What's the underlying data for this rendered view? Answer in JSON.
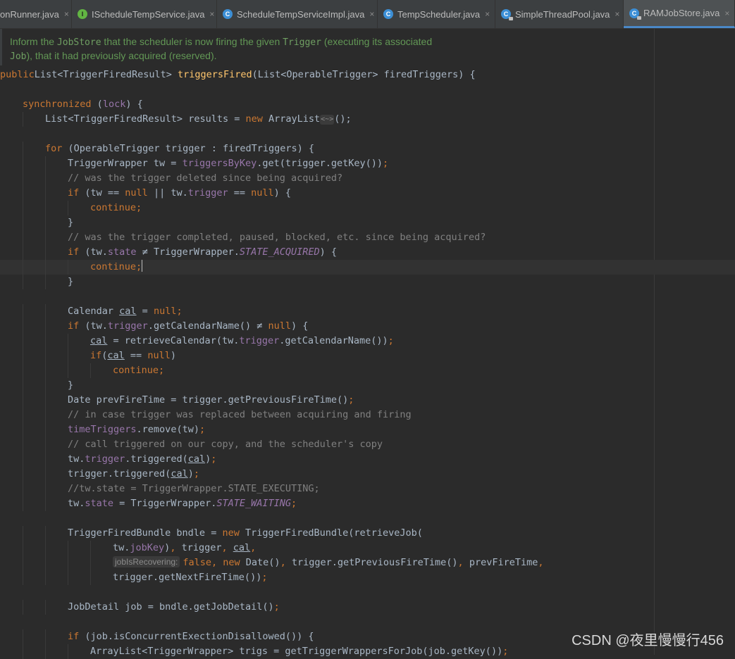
{
  "tabs": [
    {
      "label": "onRunner.java",
      "icon": "none",
      "active": false
    },
    {
      "label": "IScheduleTempService.java",
      "icon": "interface",
      "icon_letter": "I",
      "active": false
    },
    {
      "label": "ScheduleTempServiceImpl.java",
      "icon": "class",
      "icon_letter": "C",
      "active": false
    },
    {
      "label": "TempScheduler.java",
      "icon": "class",
      "icon_letter": "C",
      "active": false
    },
    {
      "label": "SimpleThreadPool.java",
      "icon": "class-locked",
      "icon_letter": "C",
      "active": false
    },
    {
      "label": "RAMJobStore.java",
      "icon": "class-locked",
      "icon_letter": "C",
      "active": true
    }
  ],
  "tab_close_glyph": "×",
  "doc_comment": {
    "line1": [
      "Inform the ",
      "JobStore",
      " that the scheduler is now firing the given ",
      "Trigger",
      " (executing its associated"
    ],
    "line2": [
      "Job",
      "), that it had previously acquired (reserved)."
    ]
  },
  "code_lines": [
    {
      "indent": 0,
      "tokens": [
        [
          "kw",
          "public"
        ],
        [
          "",
          "List<TriggerFiredResult> "
        ],
        [
          "fn",
          "triggersFired"
        ],
        [
          "",
          "(List<OperableTrigger> firedTriggers) {"
        ]
      ]
    },
    {
      "indent": 0,
      "tokens": []
    },
    {
      "indent": 1,
      "tokens": [
        [
          "kw",
          "synchronized"
        ],
        [
          "",
          " ("
        ],
        [
          "fld",
          "lock"
        ],
        [
          "",
          ") {"
        ]
      ]
    },
    {
      "indent": 2,
      "tokens": [
        [
          "",
          "List<TriggerFiredResult> results = "
        ],
        [
          "kw",
          "new "
        ],
        [
          "",
          "ArrayList"
        ],
        [
          "diamond",
          "<~>"
        ],
        [
          "",
          "();"
        ]
      ]
    },
    {
      "indent": 0,
      "tokens": []
    },
    {
      "indent": 2,
      "tokens": [
        [
          "kw",
          "for "
        ],
        [
          "",
          "(OperableTrigger trigger : firedTriggers) {"
        ]
      ]
    },
    {
      "indent": 3,
      "tokens": [
        [
          "",
          "TriggerWrapper tw = "
        ],
        [
          "fld",
          "triggersByKey"
        ],
        [
          "",
          ".get(trigger.getKey())"
        ],
        [
          "kw",
          ";"
        ]
      ]
    },
    {
      "indent": 3,
      "tokens": [
        [
          "cmt",
          "// was the trigger deleted since being acquired?"
        ]
      ]
    },
    {
      "indent": 3,
      "tokens": [
        [
          "kw",
          "if "
        ],
        [
          "",
          "(tw == "
        ],
        [
          "kw",
          "null "
        ],
        [
          "",
          "|| tw."
        ],
        [
          "fld",
          "trigger "
        ],
        [
          "",
          "== "
        ],
        [
          "kw",
          "null"
        ],
        [
          "",
          ") {"
        ]
      ]
    },
    {
      "indent": 4,
      "tokens": [
        [
          "kw",
          "continue;"
        ]
      ]
    },
    {
      "indent": 3,
      "tokens": [
        [
          "",
          "}"
        ]
      ]
    },
    {
      "indent": 3,
      "tokens": [
        [
          "cmt",
          "// was the trigger completed, paused, blocked, etc. since being acquired?"
        ]
      ]
    },
    {
      "indent": 3,
      "tokens": [
        [
          "kw",
          "if "
        ],
        [
          "",
          "(tw."
        ],
        [
          "fld",
          "state "
        ],
        [
          "",
          "≠ TriggerWrapper."
        ],
        [
          "cnst",
          "STATE_ACQUIRED"
        ],
        [
          "",
          ") {"
        ]
      ]
    },
    {
      "indent": 4,
      "current": true,
      "tokens": [
        [
          "kw",
          "continue;"
        ],
        [
          "caret",
          ""
        ]
      ]
    },
    {
      "indent": 3,
      "tokens": [
        [
          "",
          "}"
        ]
      ]
    },
    {
      "indent": 0,
      "tokens": []
    },
    {
      "indent": 3,
      "tokens": [
        [
          "",
          "Calendar "
        ],
        [
          "var",
          "cal"
        ],
        [
          "",
          " = "
        ],
        [
          "kw",
          "null;"
        ]
      ]
    },
    {
      "indent": 3,
      "tokens": [
        [
          "kw",
          "if "
        ],
        [
          "",
          "(tw."
        ],
        [
          "fld",
          "trigger"
        ],
        [
          "",
          ".getCalendarName() ≠ "
        ],
        [
          "kw",
          "null"
        ],
        [
          "",
          ") {"
        ]
      ]
    },
    {
      "indent": 4,
      "tokens": [
        [
          "var",
          "cal"
        ],
        [
          "",
          " = retrieveCalendar(tw."
        ],
        [
          "fld",
          "trigger"
        ],
        [
          "",
          ".getCalendarName())"
        ],
        [
          "kw",
          ";"
        ]
      ]
    },
    {
      "indent": 4,
      "tokens": [
        [
          "kw",
          "if"
        ],
        [
          "",
          "("
        ],
        [
          "var",
          "cal"
        ],
        [
          "",
          " == "
        ],
        [
          "kw",
          "null"
        ],
        [
          "",
          ")"
        ]
      ]
    },
    {
      "indent": 5,
      "tokens": [
        [
          "kw",
          "continue;"
        ]
      ]
    },
    {
      "indent": 3,
      "tokens": [
        [
          "",
          "}"
        ]
      ]
    },
    {
      "indent": 3,
      "tokens": [
        [
          "",
          "Date prevFireTime = trigger.getPreviousFireTime()"
        ],
        [
          "kw",
          ";"
        ]
      ]
    },
    {
      "indent": 3,
      "tokens": [
        [
          "cmt",
          "// in case trigger was replaced between acquiring and firing"
        ]
      ]
    },
    {
      "indent": 3,
      "tokens": [
        [
          "fld",
          "timeTriggers"
        ],
        [
          "",
          ".remove(tw)"
        ],
        [
          "kw",
          ";"
        ]
      ]
    },
    {
      "indent": 3,
      "tokens": [
        [
          "cmt",
          "// call triggered on our copy, and the scheduler's copy"
        ]
      ]
    },
    {
      "indent": 3,
      "tokens": [
        [
          "",
          "tw."
        ],
        [
          "fld",
          "trigger"
        ],
        [
          "",
          ".triggered("
        ],
        [
          "var",
          "cal"
        ],
        [
          "",
          ")"
        ],
        [
          "kw",
          ";"
        ]
      ]
    },
    {
      "indent": 3,
      "tokens": [
        [
          "",
          "trigger.triggered("
        ],
        [
          "var",
          "cal"
        ],
        [
          "",
          ")"
        ],
        [
          "kw",
          ";"
        ]
      ]
    },
    {
      "indent": 3,
      "tokens": [
        [
          "cmt",
          "//tw.state = TriggerWrapper.STATE_EXECUTING;"
        ]
      ]
    },
    {
      "indent": 3,
      "tokens": [
        [
          "",
          "tw."
        ],
        [
          "fld",
          "state"
        ],
        [
          "",
          " = TriggerWrapper."
        ],
        [
          "cnst",
          "STATE_WAITING"
        ],
        [
          "kw",
          ";"
        ]
      ]
    },
    {
      "indent": 0,
      "tokens": []
    },
    {
      "indent": 3,
      "tokens": [
        [
          "",
          "TriggerFiredBundle bndle = "
        ],
        [
          "kw",
          "new "
        ],
        [
          "",
          "TriggerFiredBundle(retrieveJob("
        ]
      ]
    },
    {
      "indent": 5,
      "tokens": [
        [
          "",
          "tw."
        ],
        [
          "fld",
          "jobKey"
        ],
        [
          "",
          ")"
        ],
        [
          "kw",
          ", "
        ],
        [
          "",
          "trigger"
        ],
        [
          "kw",
          ", "
        ],
        [
          "var",
          "cal"
        ],
        [
          "kw",
          ","
        ]
      ]
    },
    {
      "indent": 5,
      "tokens": [
        [
          "hint",
          "jobIsRecovering:"
        ],
        [
          "kw",
          "false, new "
        ],
        [
          "",
          "Date()"
        ],
        [
          "kw",
          ", "
        ],
        [
          "",
          "trigger.getPreviousFireTime()"
        ],
        [
          "kw",
          ", "
        ],
        [
          "",
          "prevFireTime"
        ],
        [
          "kw",
          ","
        ]
      ]
    },
    {
      "indent": 5,
      "tokens": [
        [
          "",
          "trigger.getNextFireTime())"
        ],
        [
          "kw",
          ";"
        ]
      ]
    },
    {
      "indent": 0,
      "tokens": []
    },
    {
      "indent": 3,
      "tokens": [
        [
          "",
          "JobDetail job = bndle.getJobDetail()"
        ],
        [
          "kw",
          ";"
        ]
      ]
    },
    {
      "indent": 0,
      "tokens": []
    },
    {
      "indent": 3,
      "tokens": [
        [
          "kw",
          "if "
        ],
        [
          "",
          "(job.isConcurrentExectionDisallowed()) {"
        ]
      ]
    },
    {
      "indent": 4,
      "tokens": [
        [
          "",
          "ArrayList<TriggerWrapper> trigs = getTriggerWrappersForJob(job.getKey())"
        ],
        [
          "kw",
          ";"
        ]
      ]
    }
  ],
  "watermark": "CSDN @夜里慢慢行456"
}
